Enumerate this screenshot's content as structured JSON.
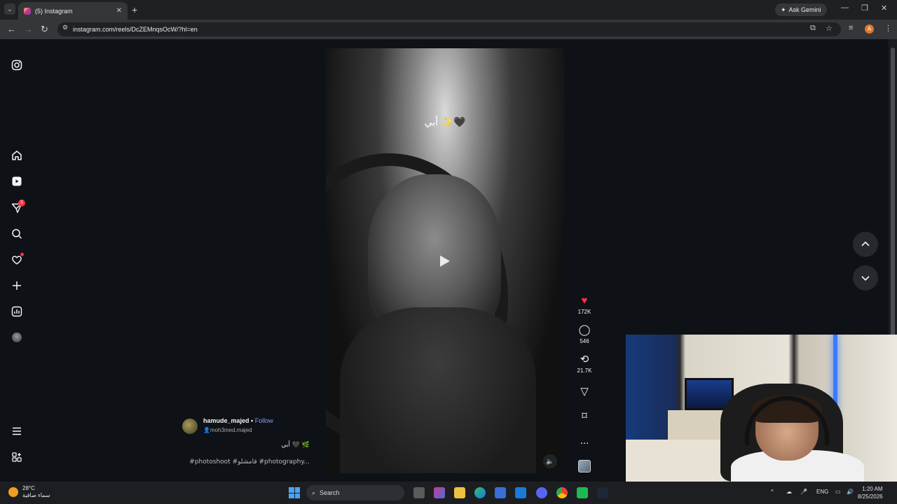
{
  "browser": {
    "tab_title": "(5) Instagram",
    "ask_gemini": "Ask Gemini",
    "url": "instagram.com/reels/DcZEMnqsOcW/?hl=en",
    "profile_initial": "A"
  },
  "sidebar": {
    "notification_count": "5"
  },
  "reel": {
    "video_text": "أبي ✨🖤",
    "likes": "172K",
    "comments": "546",
    "reposts": "21.7K",
    "more": "...",
    "author": "hamude_majed",
    "follow": "Follow",
    "author_sub": "moh3med.majed",
    "caption": "أبي 🖤 🌿",
    "hashtags": "#photoshoot #قامشلو #photography..."
  },
  "taskbar": {
    "temperature": "28°C",
    "weather_desc": "سماء صافية",
    "search_placeholder": "Search",
    "language": "ENG",
    "time": "1:20 AM",
    "date": "8/25/2026"
  },
  "colors": {
    "accent_like": "#ff3040",
    "follow_link": "#8c9cff",
    "background": "#0e1216"
  }
}
